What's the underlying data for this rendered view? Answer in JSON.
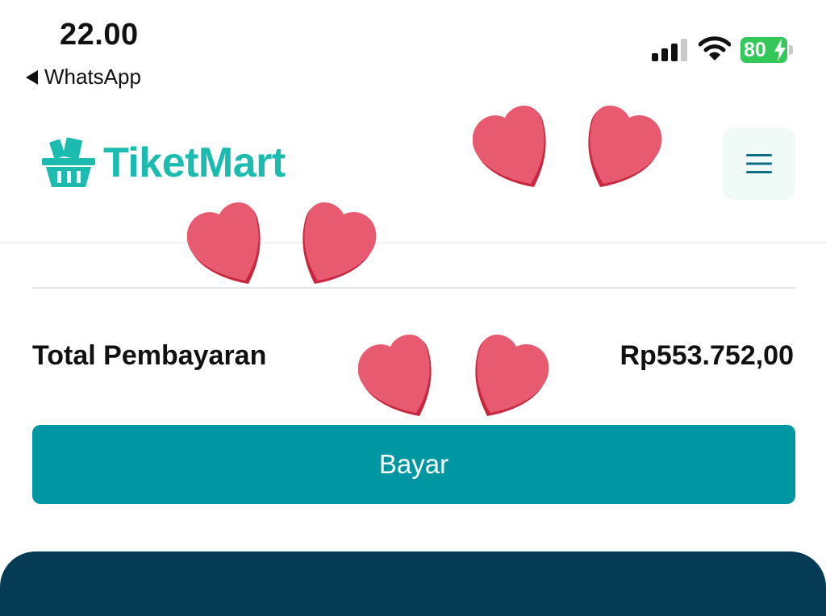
{
  "status_bar": {
    "time": "22.00",
    "back_app": "WhatsApp",
    "battery": "80"
  },
  "header": {
    "brand": "TiketMart",
    "menu_icon": "hamburger-menu-icon"
  },
  "payment": {
    "total_label": "Total Pembayaran",
    "total_value": "Rp553.752,00",
    "pay_button": "Bayar"
  },
  "colors": {
    "brand": "#1bbbb0",
    "primary_button": "#0096a2",
    "footer": "#063b56",
    "battery": "#34c759",
    "heart": "#e85a70"
  },
  "decorations": [
    "heart-sticker",
    "heart-sticker",
    "heart-sticker",
    "heart-sticker",
    "heart-sticker",
    "heart-sticker"
  ]
}
